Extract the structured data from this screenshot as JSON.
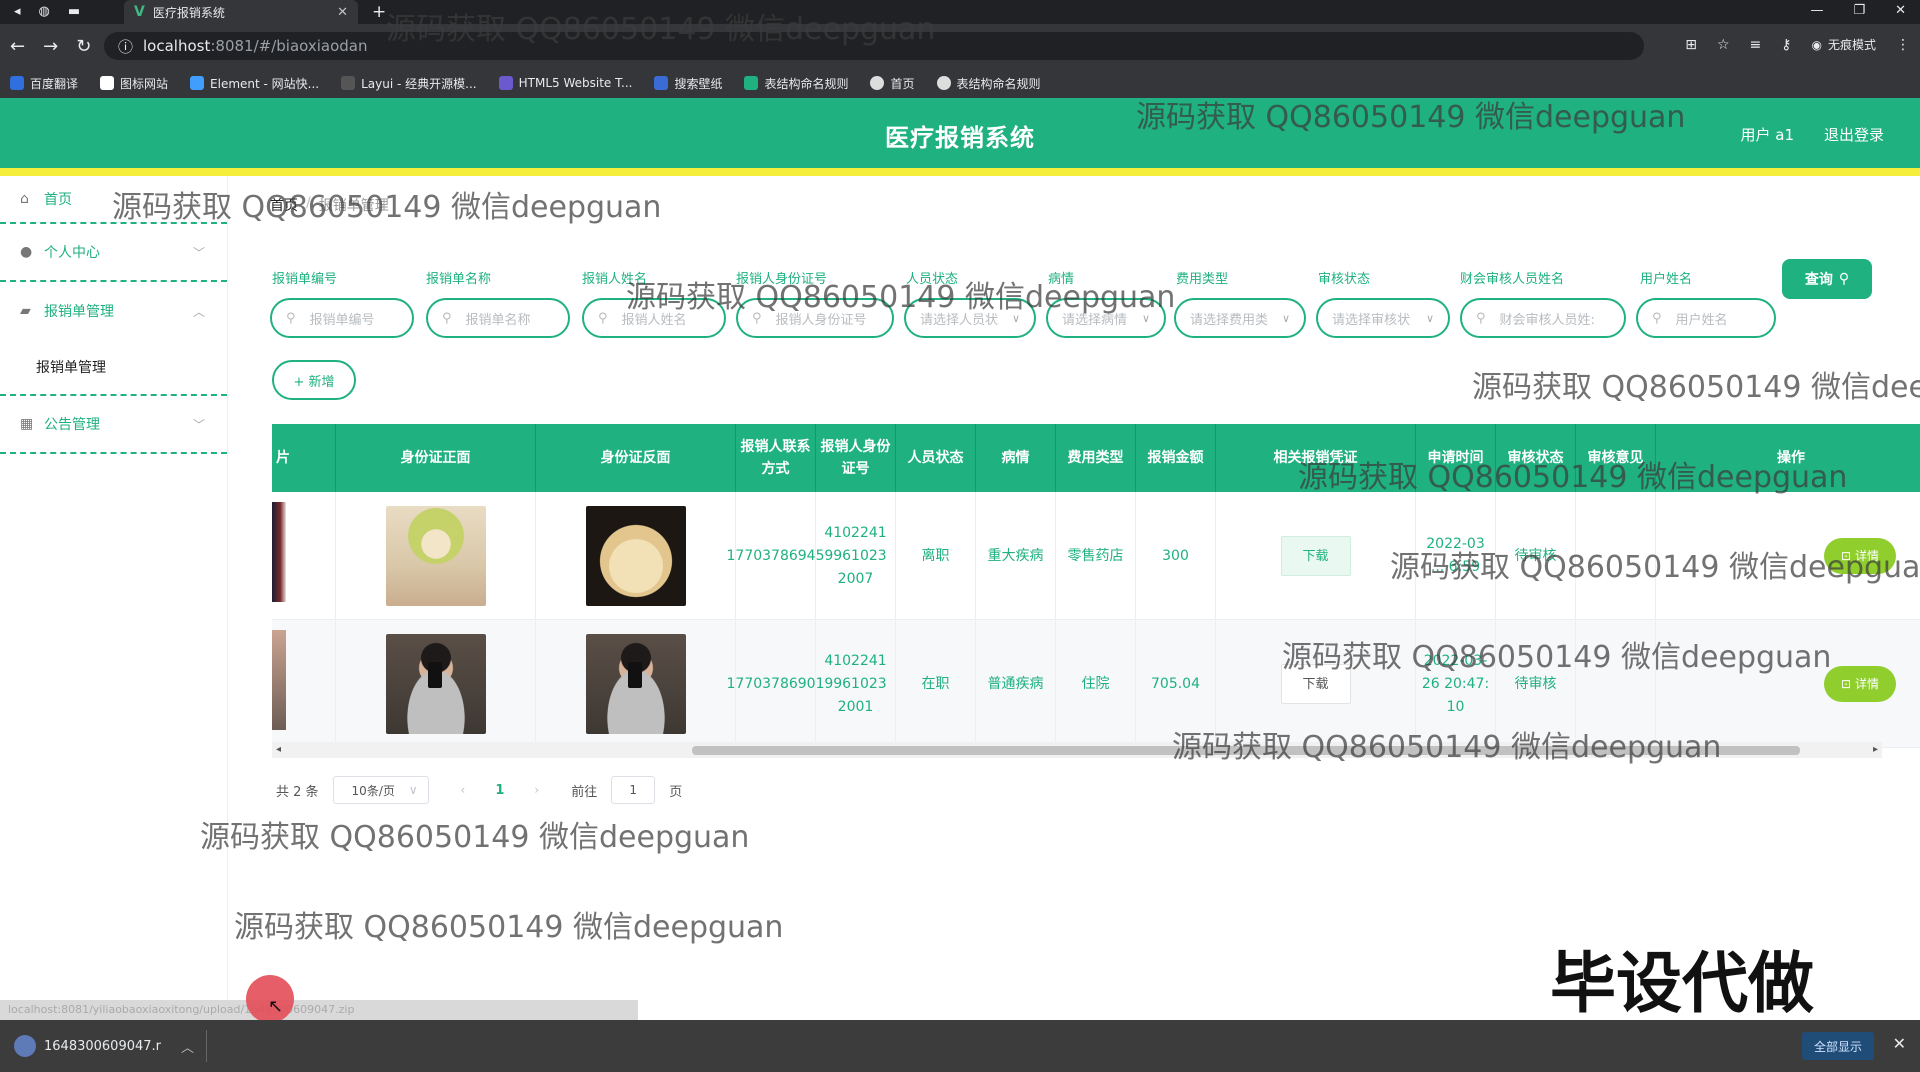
{
  "browser": {
    "tab_title": "医疗报销系统",
    "url_host": "localhost",
    "url_rest": ":8081/#/biaoxiaodan",
    "incognito_label": "无痕模式",
    "bookmarks": [
      "百度翻译",
      "图标网站",
      "Element - 网站快...",
      "Layui - 经典开源模...",
      "HTML5 Website T...",
      "搜索壁纸",
      "表结构命名规则",
      "首页",
      "表结构命名规则"
    ]
  },
  "header": {
    "title": "医疗报销系统",
    "user": "用户 a1",
    "logout": "退出登录"
  },
  "sidebar": {
    "home": "首页",
    "personal": "个人中心",
    "claims": "报销单管理",
    "claims_sub": "报销单管理",
    "notices": "公告管理"
  },
  "breadcrumb": {
    "first": "首页",
    "second": "报销单管理"
  },
  "filters": {
    "labels": [
      "报销单编号",
      "报销单名称",
      "报销人姓名",
      "报销人身份证号",
      "人员状态",
      "病情",
      "费用类型",
      "审核状态",
      "财会审核人员姓名",
      "用户姓名"
    ],
    "placeholders": [
      "报销单编号",
      "报销单名称",
      "报销人姓名",
      "报销人身份证号",
      "请选择人员状",
      "请选择病情",
      "请选择费用类",
      "请选择审核状",
      "财会审核人员姓:",
      "用户姓名"
    ],
    "query_label": "查询",
    "add_label": "+ 新增"
  },
  "table": {
    "headers": [
      "片",
      "身份证正面",
      "身份证反面",
      "报销人联系方式",
      "报销人身份证号",
      "人员状态",
      "病情",
      "费用类型",
      "报销金额",
      "相关报销凭证",
      "申请时间",
      "审核状态",
      "审核意见",
      "操作"
    ],
    "rows": [
      {
        "phone": "17703786945",
        "id_number": "410224199610232007",
        "status": "离职",
        "illness": "重大疾病",
        "fee_type": "零售药店",
        "amount": "300",
        "voucher_btn": "下载",
        "apply_time": "2022-03 ... 6:59",
        "review_status": "待审核",
        "review_opinion": "",
        "action": "详情"
      },
      {
        "phone": "17703786901",
        "id_number": "410224199610232001",
        "status": "在职",
        "illness": "普通疾病",
        "fee_type": "住院",
        "amount": "705.04",
        "voucher_btn": "下载",
        "apply_time": "2022-03-26 20:47:10",
        "review_status": "待审核",
        "review_opinion": "",
        "action": "详情"
      }
    ]
  },
  "pagination": {
    "total": "共 2 条",
    "page_size": "10条/页",
    "current": "1",
    "goto_label": "前往",
    "goto_value": "1",
    "page_unit": "页"
  },
  "watermarks": {
    "text": "源码获取 QQ86050149 微信deepguan",
    "big": "毕设代做"
  },
  "downloads": {
    "file": "1648300609047.r",
    "show_all": "全部显示"
  },
  "colors": {
    "brand": "#1fb17f",
    "accent_strip": "#f5ef3c",
    "detail_btn": "#8fce2d"
  }
}
